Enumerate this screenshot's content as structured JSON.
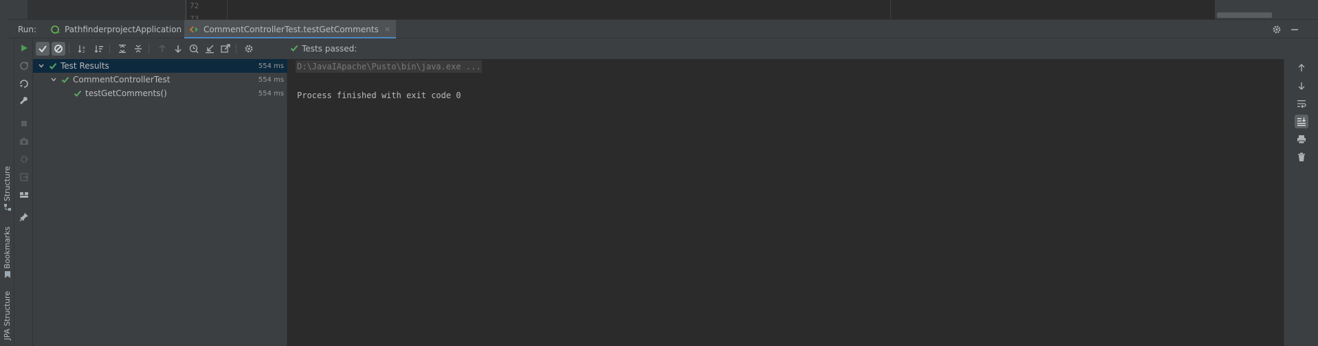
{
  "editor": {
    "line_numbers": [
      "72",
      "73"
    ]
  },
  "run_panel": {
    "label": "Run:",
    "tabs": [
      {
        "label": "PathfinderprojectApplication",
        "icon": "spring-boot-icon",
        "active": false
      },
      {
        "label": "CommentControllerTest.testGetComments",
        "icon": "test-class-icon",
        "active": true
      }
    ],
    "close_glyph": "×"
  },
  "left_stripe": {
    "tabs": [
      "Structure",
      "Bookmarks",
      "JPA Structure"
    ]
  },
  "status": {
    "text": "Tests passed:",
    "color": "#59a869"
  },
  "test_tree": {
    "rows": [
      {
        "label": "Test Results",
        "duration": "554 ms",
        "level": 0,
        "expanded": true,
        "selected": true
      },
      {
        "label": "CommentControllerTest",
        "duration": "554 ms",
        "level": 1,
        "expanded": true,
        "selected": false
      },
      {
        "label": "testGetComments()",
        "duration": "554 ms",
        "level": 2,
        "expanded": false,
        "selected": false
      }
    ]
  },
  "console": {
    "command_line": "D:\\JavaIApache\\Pusto\\bin\\java.exe ...",
    "process_line": "Process finished with exit code 0"
  },
  "colors": {
    "accent": "#4a88c7",
    "pass_green": "#59a869",
    "run_green": "#499c54",
    "panel_bg": "#3c3f41",
    "console_bg": "#2b2b2b",
    "selection_bg": "#0d293e"
  }
}
